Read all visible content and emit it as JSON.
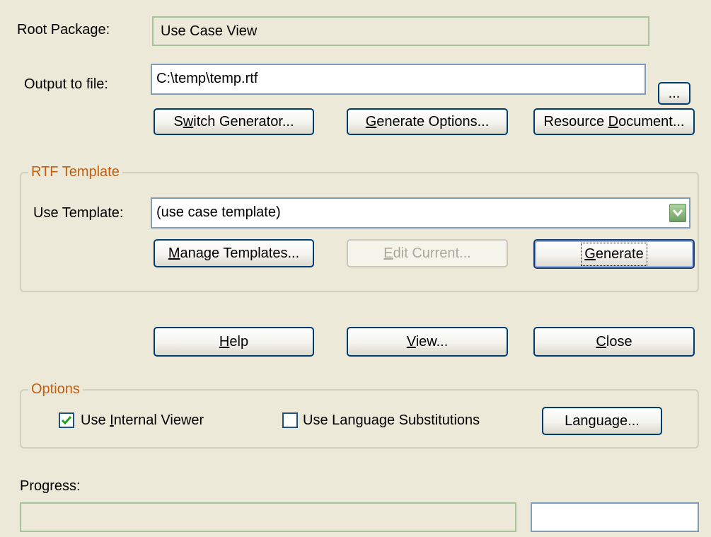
{
  "root_package": {
    "label": "Root Package:",
    "value": "Use Case View"
  },
  "output": {
    "label": "Output to file:",
    "value": "C:\\temp\\temp.rtf",
    "browse_label": "..."
  },
  "top_buttons": {
    "switch_generator": {
      "pre": "S",
      "accel": "w",
      "post": "itch Generator..."
    },
    "generate_options": {
      "pre": "",
      "accel": "G",
      "post": "enerate Options..."
    },
    "resource_document": {
      "pre": "Resource ",
      "accel": "D",
      "post": "ocument..."
    }
  },
  "rtf_template": {
    "title": "RTF Template",
    "use_template_label": "Use Template:",
    "selected_template": "(use case template)",
    "manage": {
      "pre": "",
      "accel": "M",
      "post": "anage Templates..."
    },
    "edit_current": {
      "pre": "",
      "accel": "E",
      "post": "dit Current..."
    },
    "generate": {
      "pre": "",
      "accel": "G",
      "post": "enerate"
    }
  },
  "action_buttons": {
    "help": {
      "pre": "",
      "accel": "H",
      "post": "elp"
    },
    "view": {
      "pre": "",
      "accel": "V",
      "post": "iew..."
    },
    "close": {
      "pre": "",
      "accel": "C",
      "post": "lose"
    }
  },
  "options": {
    "title": "Options",
    "internal_viewer": {
      "pre": "Use ",
      "accel": "I",
      "post": "nternal Viewer",
      "checked": true
    },
    "language_substitutions": {
      "label": "Use Language Substitutions",
      "checked": false
    },
    "language_button": "Language..."
  },
  "progress": {
    "label": "Progress:",
    "percent": 0,
    "status_text": ""
  },
  "colors": {
    "background": "#ece9d8",
    "group_title": "#c25e0e",
    "button_border": "#003c74",
    "check": "#21a121"
  },
  "icons": {
    "combo_arrow": "chevron-down-icon",
    "check": "checkmark-icon"
  }
}
